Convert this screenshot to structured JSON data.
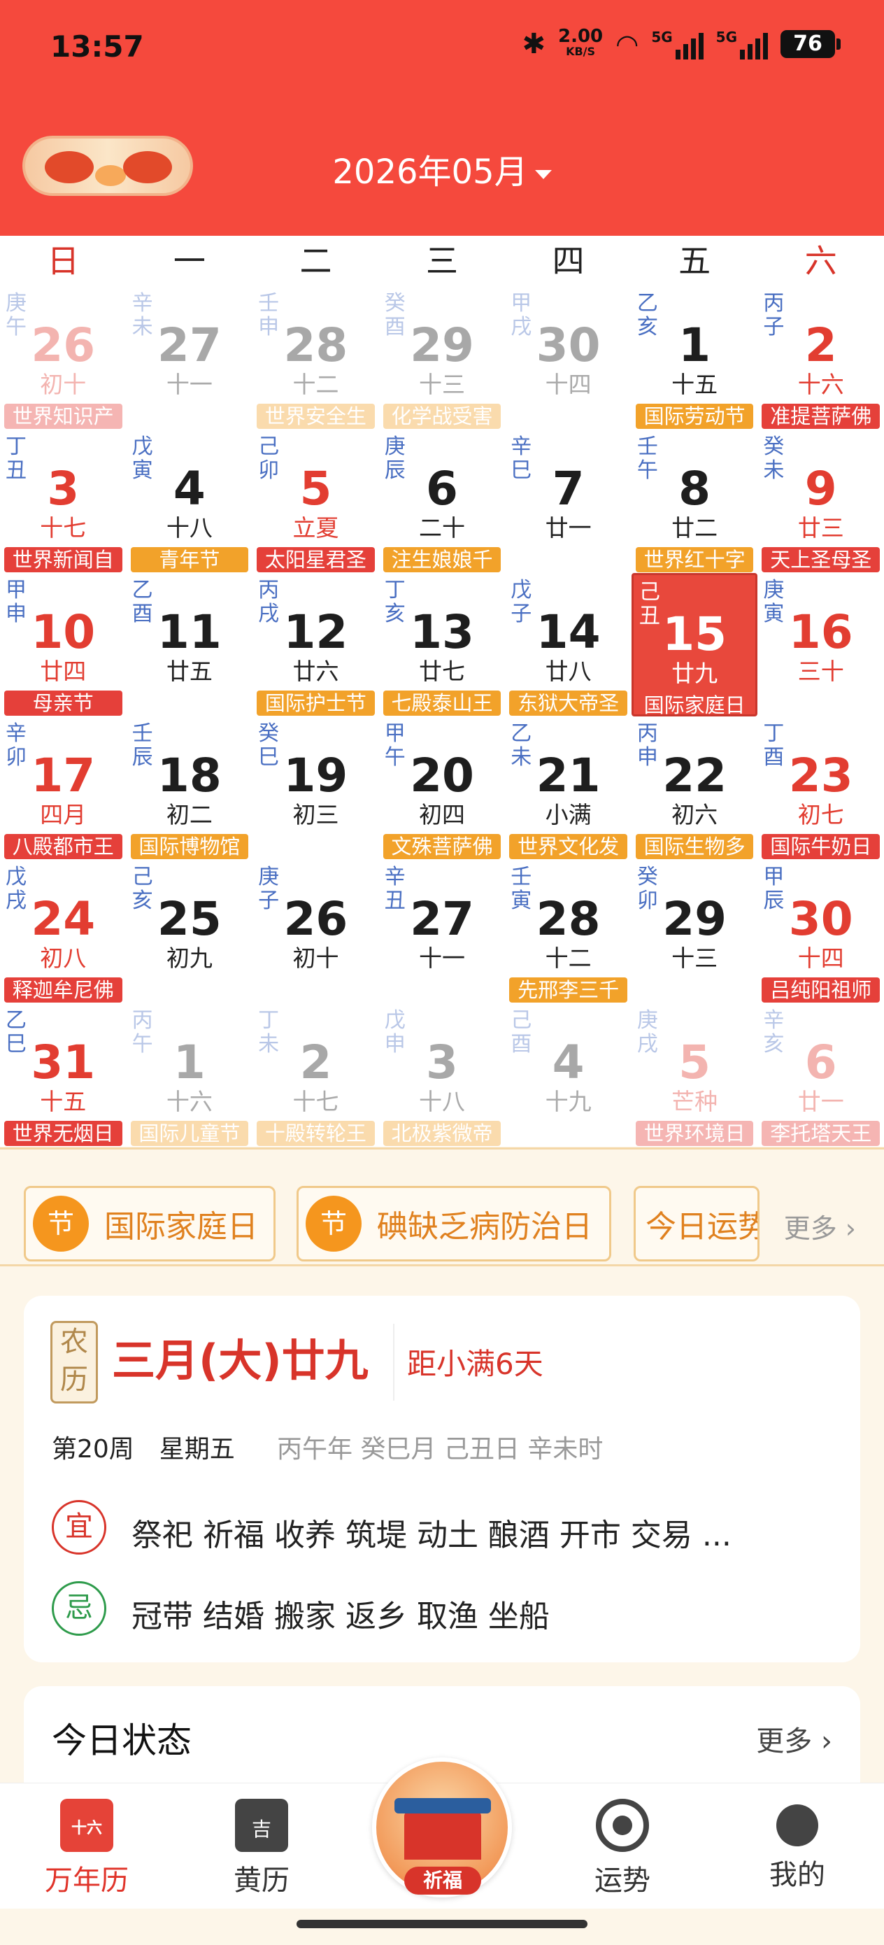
{
  "status_bar": {
    "time": "13:57",
    "speed_value": "2.00",
    "speed_unit": "KB/S",
    "net_1": "5G",
    "net_2": "5G",
    "battery": "76"
  },
  "header": {
    "month_title": "2026年05月"
  },
  "weekdays": [
    "日",
    "一",
    "二",
    "三",
    "四",
    "五",
    "六"
  ],
  "days": [
    {
      "gz": "庚午",
      "num": "26",
      "lunar": "初十",
      "fest": "世界知识产",
      "ft": "r",
      "other": true,
      "wk": true
    },
    {
      "gz": "辛未",
      "num": "27",
      "lunar": "十一",
      "fest": "",
      "ft": "",
      "other": true,
      "wk": false
    },
    {
      "gz": "壬申",
      "num": "28",
      "lunar": "十二",
      "fest": "世界安全生",
      "ft": "o",
      "other": true,
      "wk": false
    },
    {
      "gz": "癸酉",
      "num": "29",
      "lunar": "十三",
      "fest": "化学战受害",
      "ft": "o",
      "other": true,
      "wk": false
    },
    {
      "gz": "甲戌",
      "num": "30",
      "lunar": "十四",
      "fest": "",
      "ft": "",
      "other": true,
      "wk": false
    },
    {
      "gz": "乙亥",
      "num": "1",
      "lunar": "十五",
      "fest": "国际劳动节",
      "ft": "o",
      "other": false,
      "wk": false
    },
    {
      "gz": "丙子",
      "num": "2",
      "lunar": "十六",
      "fest": "准提菩萨佛",
      "ft": "r",
      "other": false,
      "wk": true
    },
    {
      "gz": "丁丑",
      "num": "3",
      "lunar": "十七",
      "fest": "世界新闻自",
      "ft": "r",
      "other": false,
      "wk": true
    },
    {
      "gz": "戊寅",
      "num": "4",
      "lunar": "十八",
      "fest": "青年节",
      "ft": "o",
      "other": false,
      "wk": false
    },
    {
      "gz": "己卯",
      "num": "5",
      "lunar": "立夏",
      "fest": "太阳星君圣",
      "ft": "r",
      "other": false,
      "wk": true
    },
    {
      "gz": "庚辰",
      "num": "6",
      "lunar": "二十",
      "fest": "注生娘娘千",
      "ft": "o",
      "other": false,
      "wk": false
    },
    {
      "gz": "辛巳",
      "num": "7",
      "lunar": "廿一",
      "fest": "",
      "ft": "",
      "other": false,
      "wk": false
    },
    {
      "gz": "壬午",
      "num": "8",
      "lunar": "廿二",
      "fest": "世界红十字",
      "ft": "o",
      "other": false,
      "wk": false
    },
    {
      "gz": "癸未",
      "num": "9",
      "lunar": "廿三",
      "fest": "天上圣母圣",
      "ft": "r",
      "other": false,
      "wk": true
    },
    {
      "gz": "甲申",
      "num": "10",
      "lunar": "廿四",
      "fest": "母亲节",
      "ft": "r",
      "other": false,
      "wk": true
    },
    {
      "gz": "乙酉",
      "num": "11",
      "lunar": "廿五",
      "fest": "",
      "ft": "",
      "other": false,
      "wk": false
    },
    {
      "gz": "丙戌",
      "num": "12",
      "lunar": "廿六",
      "fest": "国际护士节",
      "ft": "o",
      "other": false,
      "wk": false
    },
    {
      "gz": "丁亥",
      "num": "13",
      "lunar": "廿七",
      "fest": "七殿泰山王",
      "ft": "o",
      "other": false,
      "wk": false
    },
    {
      "gz": "戊子",
      "num": "14",
      "lunar": "廿八",
      "fest": "东狱大帝圣",
      "ft": "o",
      "other": false,
      "wk": false
    },
    {
      "gz": "己丑",
      "num": "15",
      "lunar": "廿九",
      "fest": "国际家庭日",
      "ft": "r",
      "other": false,
      "wk": false,
      "today": true
    },
    {
      "gz": "庚寅",
      "num": "16",
      "lunar": "三十",
      "fest": "",
      "ft": "",
      "other": false,
      "wk": true
    },
    {
      "gz": "辛卯",
      "num": "17",
      "lunar": "四月",
      "fest": "八殿都市王",
      "ft": "r",
      "other": false,
      "wk": true
    },
    {
      "gz": "壬辰",
      "num": "18",
      "lunar": "初二",
      "fest": "国际博物馆",
      "ft": "o",
      "other": false,
      "wk": false
    },
    {
      "gz": "癸巳",
      "num": "19",
      "lunar": "初三",
      "fest": "",
      "ft": "",
      "other": false,
      "wk": false
    },
    {
      "gz": "甲午",
      "num": "20",
      "lunar": "初四",
      "fest": "文殊菩萨佛",
      "ft": "o",
      "other": false,
      "wk": false
    },
    {
      "gz": "乙未",
      "num": "21",
      "lunar": "小满",
      "fest": "世界文化发",
      "ft": "o",
      "other": false,
      "wk": false
    },
    {
      "gz": "丙申",
      "num": "22",
      "lunar": "初六",
      "fest": "国际生物多",
      "ft": "o",
      "other": false,
      "wk": false
    },
    {
      "gz": "丁酉",
      "num": "23",
      "lunar": "初七",
      "fest": "国际牛奶日",
      "ft": "r",
      "other": false,
      "wk": true
    },
    {
      "gz": "戊戌",
      "num": "24",
      "lunar": "初八",
      "fest": "释迦牟尼佛",
      "ft": "r",
      "other": false,
      "wk": true
    },
    {
      "gz": "己亥",
      "num": "25",
      "lunar": "初九",
      "fest": "",
      "ft": "",
      "other": false,
      "wk": false
    },
    {
      "gz": "庚子",
      "num": "26",
      "lunar": "初十",
      "fest": "",
      "ft": "",
      "other": false,
      "wk": false
    },
    {
      "gz": "辛丑",
      "num": "27",
      "lunar": "十一",
      "fest": "",
      "ft": "",
      "other": false,
      "wk": false
    },
    {
      "gz": "壬寅",
      "num": "28",
      "lunar": "十二",
      "fest": "先邢李三千",
      "ft": "o",
      "other": false,
      "wk": false
    },
    {
      "gz": "癸卯",
      "num": "29",
      "lunar": "十三",
      "fest": "",
      "ft": "",
      "other": false,
      "wk": false
    },
    {
      "gz": "甲辰",
      "num": "30",
      "lunar": "十四",
      "fest": "吕纯阳祖师",
      "ft": "r",
      "other": false,
      "wk": true
    },
    {
      "gz": "乙巳",
      "num": "31",
      "lunar": "十五",
      "fest": "世界无烟日",
      "ft": "r",
      "other": false,
      "wk": true
    },
    {
      "gz": "丙午",
      "num": "1",
      "lunar": "十六",
      "fest": "国际儿童节",
      "ft": "o",
      "other": true,
      "wk": false
    },
    {
      "gz": "丁未",
      "num": "2",
      "lunar": "十七",
      "fest": "十殿转轮王",
      "ft": "o",
      "other": true,
      "wk": false
    },
    {
      "gz": "戊申",
      "num": "3",
      "lunar": "十八",
      "fest": "北极紫微帝",
      "ft": "o",
      "other": true,
      "wk": false
    },
    {
      "gz": "己酉",
      "num": "4",
      "lunar": "十九",
      "fest": "",
      "ft": "",
      "other": true,
      "wk": false
    },
    {
      "gz": "庚戌",
      "num": "5",
      "lunar": "芒种",
      "fest": "世界环境日",
      "ft": "r",
      "other": true,
      "wk": true
    },
    {
      "gz": "辛亥",
      "num": "6",
      "lunar": "廿一",
      "fest": "李托塔天王",
      "ft": "r",
      "other": true,
      "wk": true
    }
  ],
  "chips": {
    "chip1_badge": "节",
    "chip1_text": "国际家庭日",
    "chip2_badge": "节",
    "chip2_text": "碘缺乏病防治日",
    "chip3_text": "今日运势",
    "more": "更多"
  },
  "almanac": {
    "nongli_label": "农历",
    "lunar_date": "三月(大)廿九",
    "countdown": "距小满6天",
    "week_info": "第20周　星期五",
    "ganzhi": "丙午年 癸巳月 己丑日 辛未时",
    "yi_label": "宜",
    "yi_items": "祭祀 祈福 收养 筑堤 动土 酿酒 开市 交易 ...",
    "ji_label": "忌",
    "ji_items": "冠带 结婚 搬家 返乡 取渔 坐船"
  },
  "today_status": {
    "title": "今日状态",
    "more": "更多"
  },
  "bottom_nav": {
    "calendar": "万年历",
    "huangli": "黄历",
    "center": "祈福",
    "fortune": "运势",
    "mine": "我的"
  },
  "colors": {
    "header_red": "#f5493d",
    "weekend_red": "#e23d31",
    "festival_orange": "#f2a22a",
    "festival_red": "#e5403a"
  }
}
